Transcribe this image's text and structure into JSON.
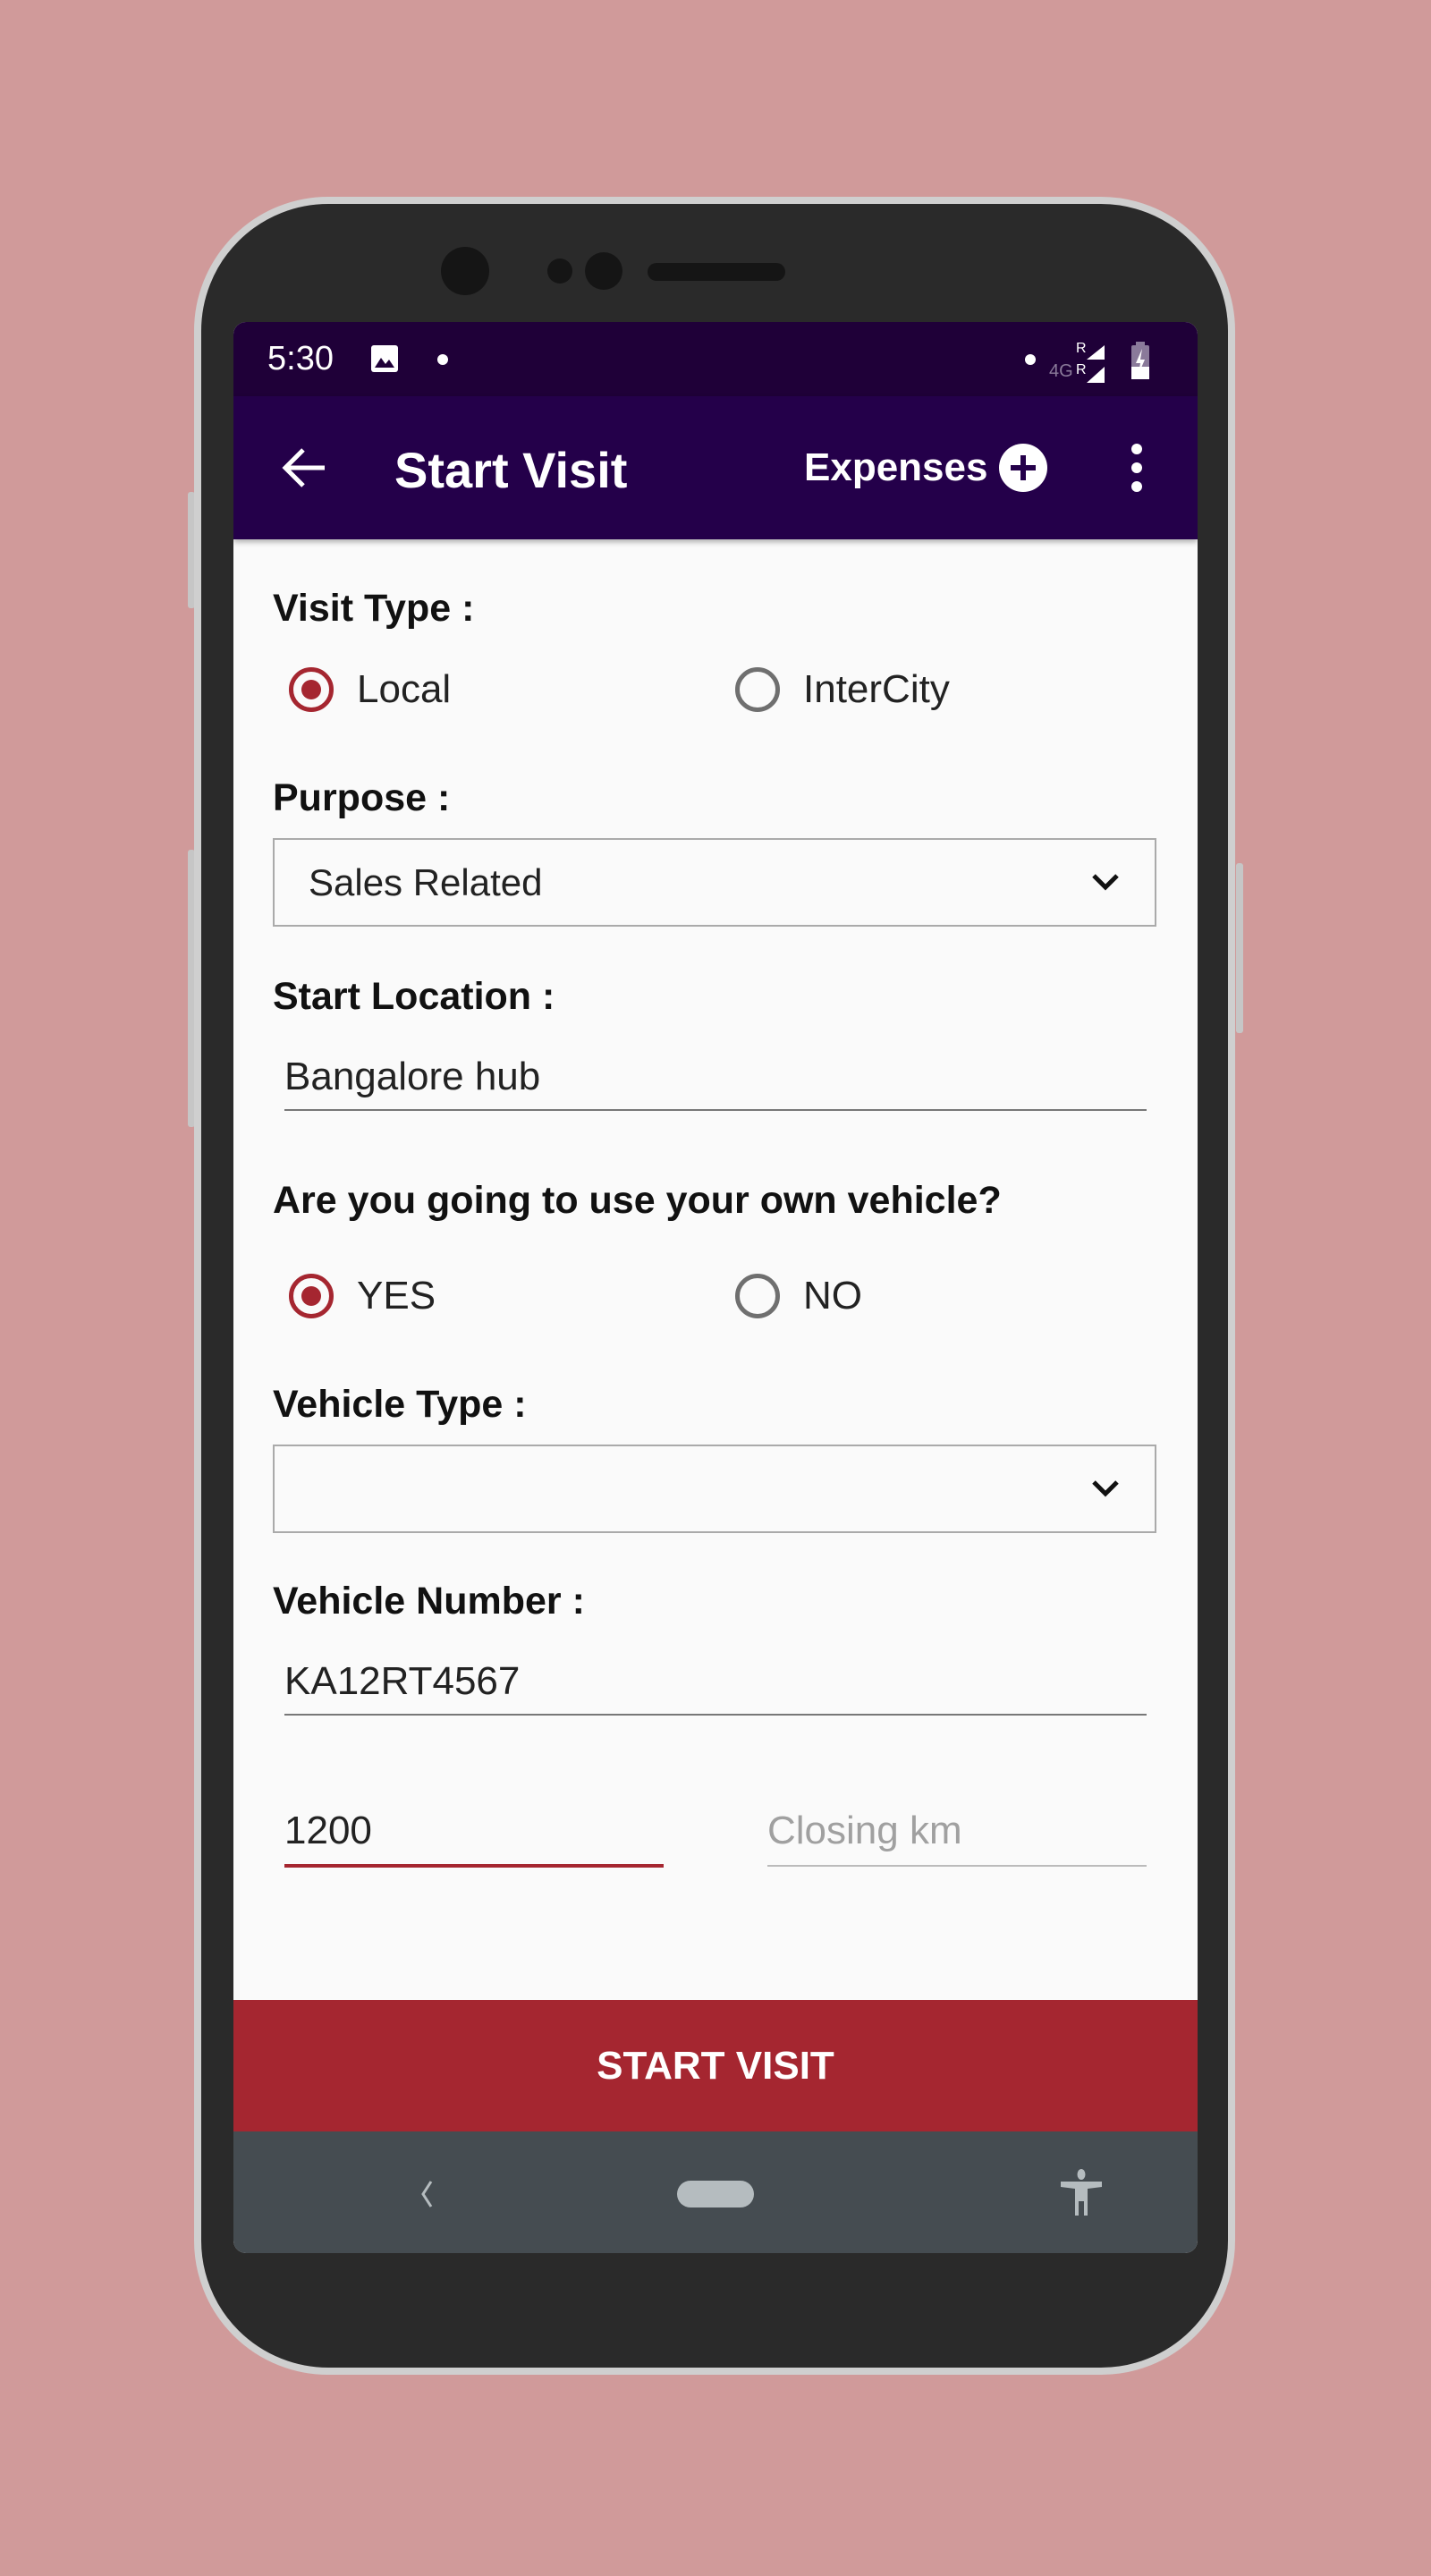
{
  "status_bar": {
    "time": "5:30",
    "network": "4G"
  },
  "app_bar": {
    "title": "Start Visit",
    "expenses_label": "Expenses"
  },
  "form": {
    "visit_type": {
      "label": "Visit Type :",
      "options": [
        "Local",
        "InterCity"
      ],
      "selected": "Local"
    },
    "purpose": {
      "label": "Purpose :",
      "value": "Sales Related"
    },
    "start_location": {
      "label": "Start Location :",
      "value": "Bangalore hub"
    },
    "own_vehicle": {
      "label": "Are you going to use your own vehicle?",
      "options": [
        "YES",
        "NO"
      ],
      "selected": "YES"
    },
    "vehicle_type": {
      "label": "Vehicle Type :",
      "value": ""
    },
    "vehicle_number": {
      "label": "Vehicle Number :",
      "value": "KA12RT4567"
    },
    "opening_km": {
      "value": "1200"
    },
    "closing_km": {
      "placeholder": "Closing km",
      "value": ""
    }
  },
  "start_button": {
    "label": "START VISIT"
  },
  "colors": {
    "accent": "#a52630",
    "app_bar": "#24004a",
    "status_bar": "#1f0038",
    "nav_bar": "#454c51"
  }
}
